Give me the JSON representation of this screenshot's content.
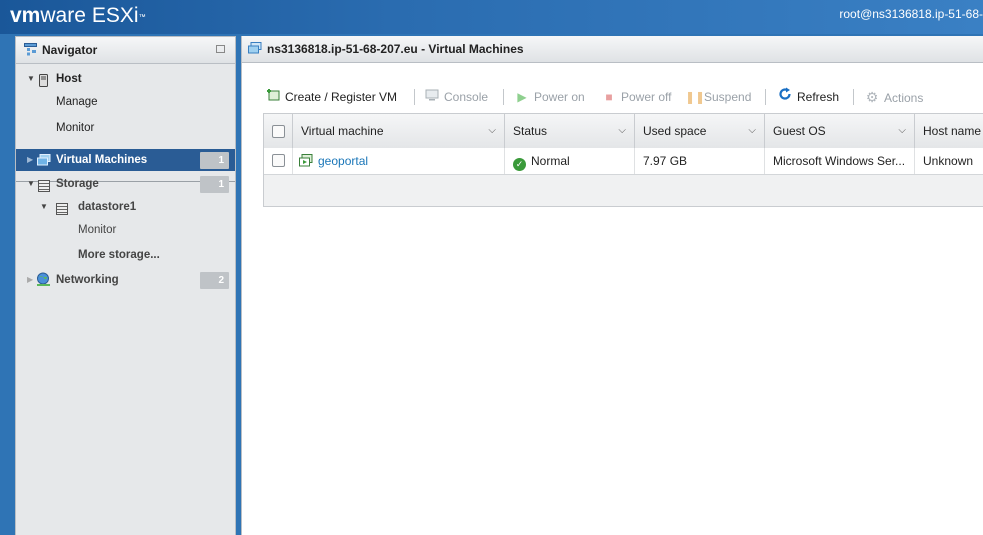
{
  "header": {
    "logo_vm": "vm",
    "logo_ware": "ware",
    "logo_product": "ESXi",
    "logo_tm": "™",
    "user": "root@ns3136818.ip-51-68-"
  },
  "navigator": {
    "title": "Navigator",
    "items": [
      {
        "label": "Host"
      },
      {
        "label": "Manage"
      },
      {
        "label": "Monitor"
      },
      {
        "label": "Virtual Machines",
        "badge": "1"
      },
      {
        "label": "Storage",
        "badge": "1"
      },
      {
        "label": "datastore1"
      },
      {
        "label": "Monitor"
      },
      {
        "label": "More storage..."
      },
      {
        "label": "Networking",
        "badge": "2"
      }
    ]
  },
  "main": {
    "title": "ns3136818.ip-51-68-207.eu - Virtual Machines",
    "toolbar": {
      "create": "Create / Register VM",
      "console": "Console",
      "power_on": "Power on",
      "power_off": "Power off",
      "suspend": "Suspend",
      "refresh": "Refresh",
      "actions": "Actions"
    },
    "columns": [
      "Virtual machine",
      "Status",
      "Used space",
      "Guest OS",
      "Host name"
    ],
    "rows": [
      {
        "name": "geoportal",
        "status": "Normal",
        "used_space": "7.97 GB",
        "guest_os": "Microsoft Windows Ser...",
        "host_name": "Unknown"
      }
    ]
  },
  "colors": {
    "accent": "#2a5c95",
    "link": "#1a76b8",
    "status_ok": "#3a9a3a"
  }
}
